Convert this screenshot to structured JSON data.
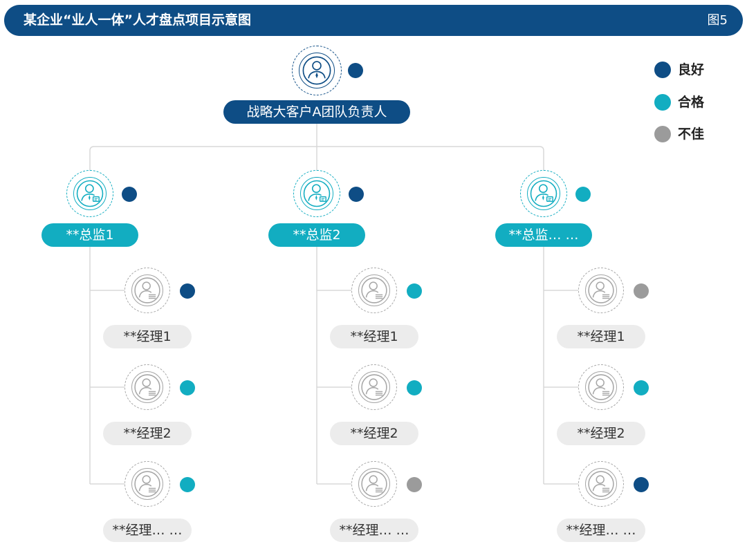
{
  "header": {
    "title": "某企业“业人一体”人才盘点项目示意图",
    "figure": "图5"
  },
  "colors": {
    "navy": "#0e4d85",
    "teal": "#12adc1",
    "gray": "#9b9b9b",
    "line": "#d8d8d8",
    "pill_gray": "#ececec"
  },
  "legend": [
    {
      "key": "good",
      "label": "良好"
    },
    {
      "key": "pass",
      "label": "合格"
    },
    {
      "key": "poor",
      "label": "不佳"
    }
  ],
  "root": {
    "label": "战略大客户A团队负责人",
    "rating": "good"
  },
  "directors": [
    {
      "label": "**总监1",
      "rating": "good",
      "managers": [
        {
          "label": "**经理1",
          "rating": "good"
        },
        {
          "label": "**经理2",
          "rating": "pass"
        },
        {
          "label": "**经理… …",
          "rating": "pass"
        }
      ]
    },
    {
      "label": "**总监2",
      "rating": "good",
      "managers": [
        {
          "label": "**经理1",
          "rating": "pass"
        },
        {
          "label": "**经理2",
          "rating": "pass"
        },
        {
          "label": "**经理… …",
          "rating": "poor"
        }
      ]
    },
    {
      "label": "**总监… …",
      "rating": "pass",
      "managers": [
        {
          "label": "**经理1",
          "rating": "poor"
        },
        {
          "label": "**经理2",
          "rating": "pass"
        },
        {
          "label": "**经理… …",
          "rating": "good"
        }
      ]
    }
  ]
}
